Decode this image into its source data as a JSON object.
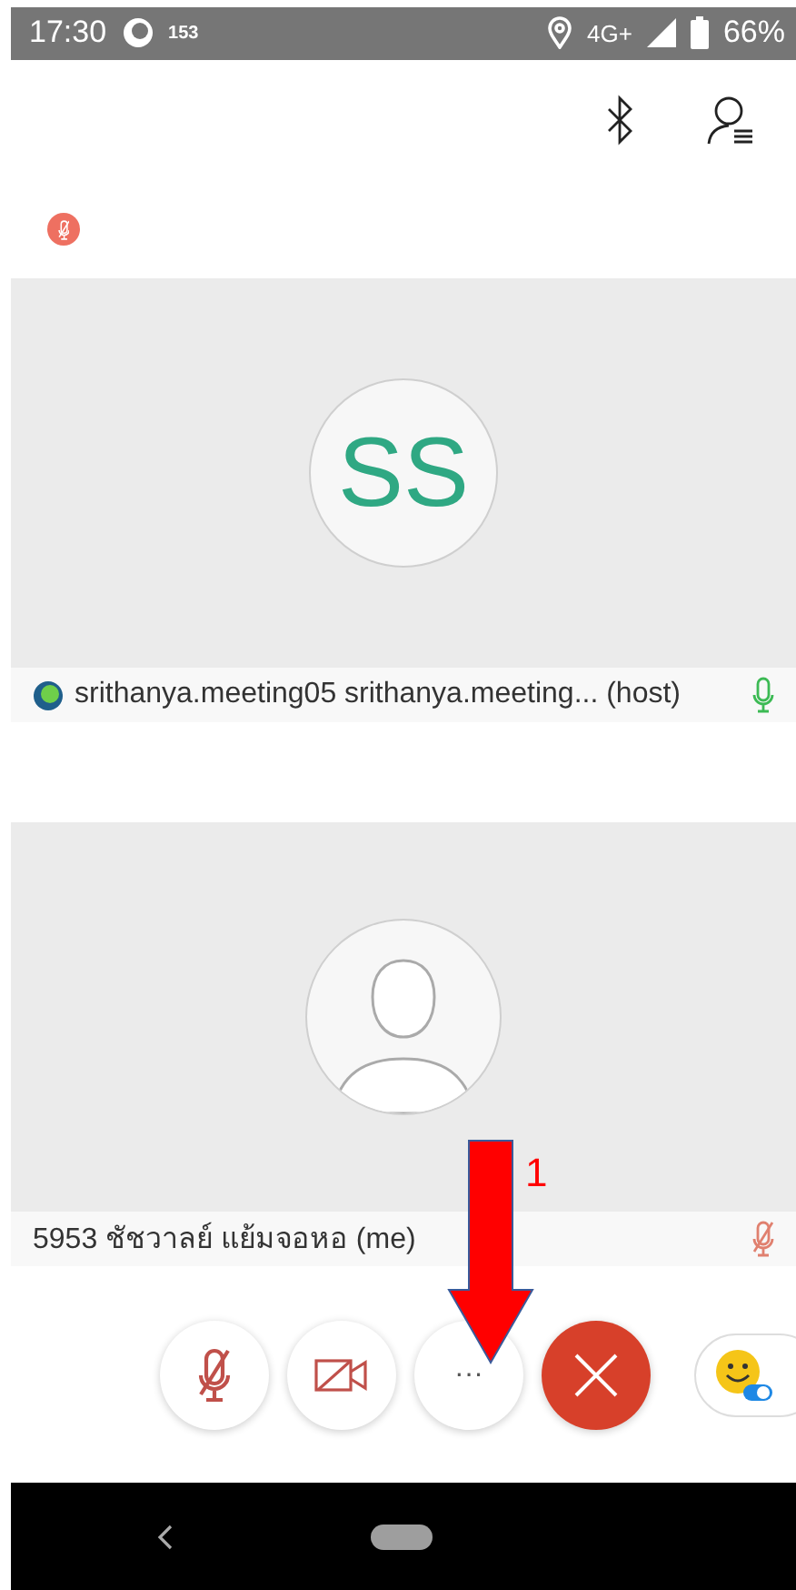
{
  "status_bar": {
    "time": "17:30",
    "notification_count": "153",
    "network": "4G+",
    "battery": "66%"
  },
  "self_muted": true,
  "participants": [
    {
      "kind": "initials",
      "initials": "SS",
      "name": "srithanya.meeting05 srithanya.meeting... (host)",
      "host": true,
      "muted": false
    },
    {
      "kind": "silhouette",
      "name": "5953 ชัชวาลย์ แย้มจอหอ (me)",
      "host": false,
      "muted": true
    }
  ],
  "controls": [
    {
      "kind": "mic",
      "muted": true
    },
    {
      "kind": "video",
      "off": true
    },
    {
      "kind": "more",
      "label": "···"
    },
    {
      "kind": "leave"
    },
    {
      "kind": "reactions"
    }
  ],
  "annotation": {
    "label": "1"
  }
}
